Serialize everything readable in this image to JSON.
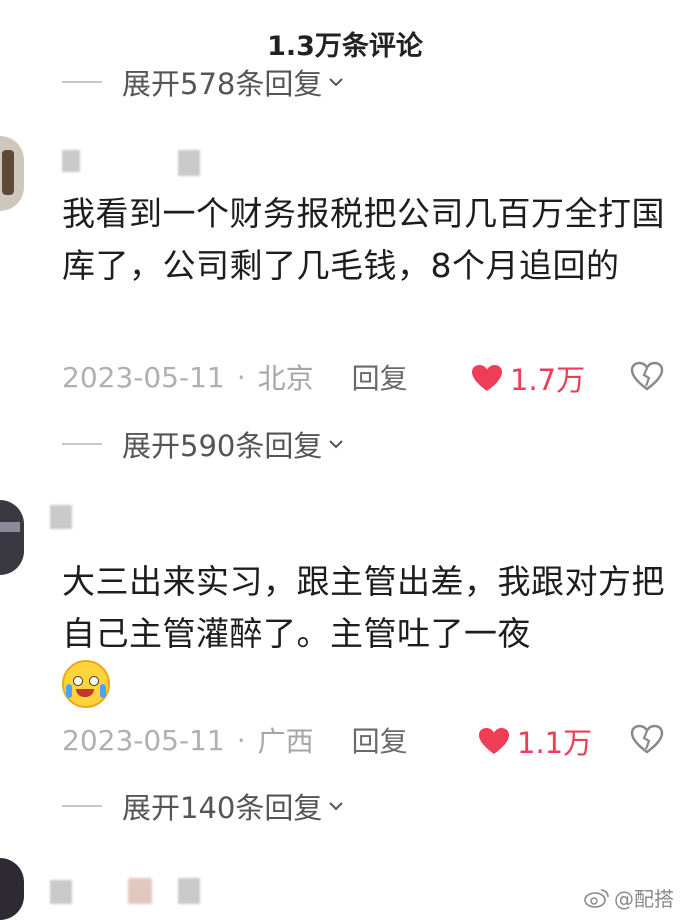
{
  "header": {
    "title": "1.3万条评论"
  },
  "top_expand": {
    "label": "展开578条回复"
  },
  "comments": [
    {
      "text": "我看到一个财务报税把公司几百万全打国库了，公司剩了几毛钱，8个月追回的",
      "date": "2023-05-11",
      "location": "北京",
      "reply_label": "回复",
      "likes": "1.7万",
      "expand_label": "展开590条回复"
    },
    {
      "text": "大三出来实习，跟主管出差，我跟对方把自己主管灌醉了。主管吐了一夜",
      "date": "2023-05-11",
      "location": "广西",
      "reply_label": "回复",
      "likes": "1.1万",
      "expand_label": "展开140条回复"
    }
  ],
  "watermark": {
    "text": "@配搭"
  },
  "colors": {
    "like": "#ef3d57",
    "muted": "#a6a6a6",
    "text": "#1d1d1d"
  }
}
